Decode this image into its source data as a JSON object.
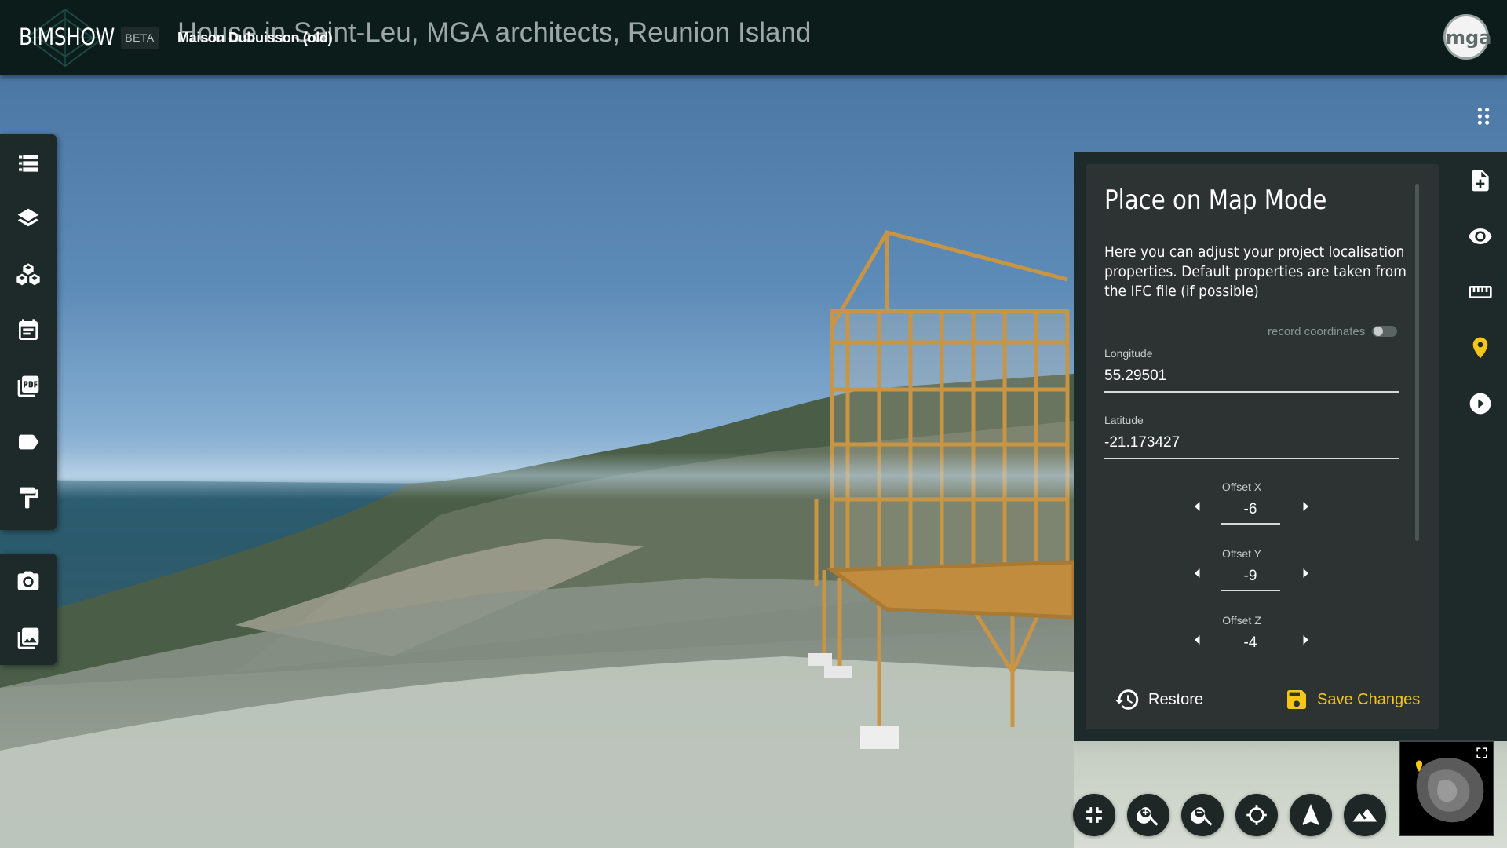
{
  "app": {
    "brand": "BIMSHOW",
    "badge": "BETA",
    "project_title": "House in Saint-Leu, MGA architects, Reunion Island",
    "project_subtitle": "Maison Dubuisson (old)",
    "user_avatar_text": "mga"
  },
  "left_toolbar": {
    "icons": [
      "list-icon",
      "layers-icon",
      "cubes-icon",
      "calendar-icon",
      "pdf-icon",
      "tag-icon",
      "paint-roller-icon"
    ],
    "secondary_icons": [
      "camera-icon",
      "gallery-icon"
    ]
  },
  "right_toolbar": {
    "icons": [
      "add-file-icon",
      "eye-icon",
      "ruler-icon",
      "map-pin-icon",
      "play-circle-icon"
    ],
    "active": "map-pin-icon",
    "active_color": "#f5c518"
  },
  "panel": {
    "title": "Place on Map Mode",
    "description": "Here you can adjust your project localisation properties. Default properties are taken from the IFC file (if possible)",
    "record_coordinates_label": "record coordinates",
    "record_coordinates_on": false,
    "longitude": {
      "label": "Longitude",
      "value": "55.29501"
    },
    "latitude": {
      "label": "Latitude",
      "value": "-21.173427"
    },
    "offset_x": {
      "label": "Offset X",
      "value": "-6"
    },
    "offset_y": {
      "label": "Offset Y",
      "value": "-9"
    },
    "offset_z": {
      "label": "Offset Z",
      "value": "-4"
    },
    "restore_label": "Restore",
    "save_label": "Save Changes"
  },
  "bottom_controls": [
    "compress-icon",
    "zoom-in-icon",
    "zoom-out-icon",
    "locate-icon",
    "north-arrow-icon",
    "terrain-icon"
  ],
  "colors": {
    "topbar": "#0b1c1b",
    "toolbar": "#1e2a29",
    "panel": "#2c3332",
    "accent": "#f5c518"
  }
}
